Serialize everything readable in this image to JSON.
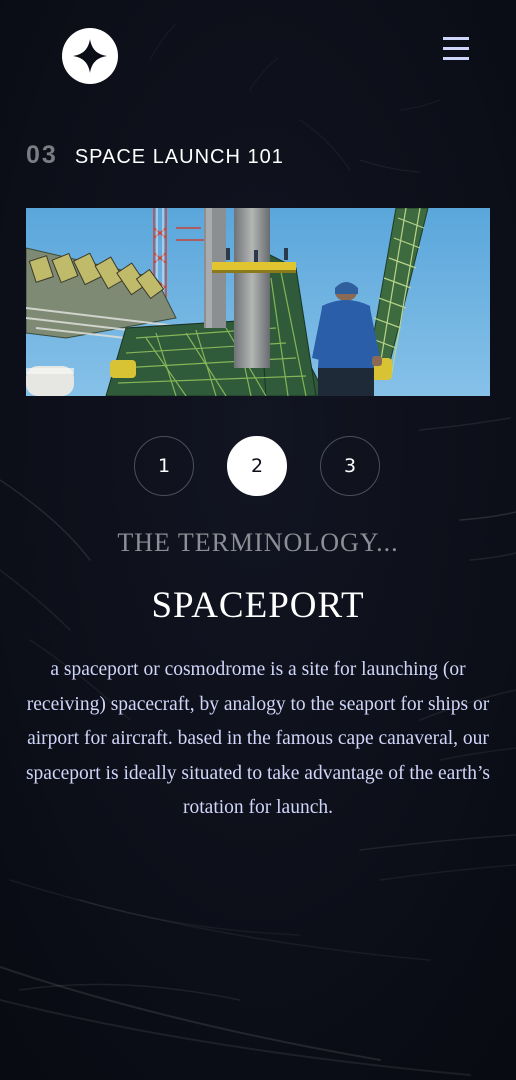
{
  "header": {
    "logo_icon": "four-point-star-icon",
    "menu_icon": "hamburger-menu-icon"
  },
  "section": {
    "number": "03",
    "title": "SPACE LAUNCH 101"
  },
  "hero_image": {
    "description_icon": "launch-pad-photo"
  },
  "pager": {
    "items": [
      "1",
      "2",
      "3"
    ],
    "active_index": 1
  },
  "terminology": {
    "kicker": "THE TERMINOLOGY...",
    "name": "SPACEPORT",
    "description": "a spaceport or cosmodrome is a site for launching (or receiving) spacecraft, by analogy to the seaport for ships or airport for aircraft. based in the famous cape canaveral, our spaceport is ideally situated to take advantage of the earth’s rotation for launch."
  },
  "colors": {
    "background": "#0b0d17",
    "text_light": "#d0d6f9",
    "text_muted": "#7b7d85",
    "white": "#ffffff"
  }
}
